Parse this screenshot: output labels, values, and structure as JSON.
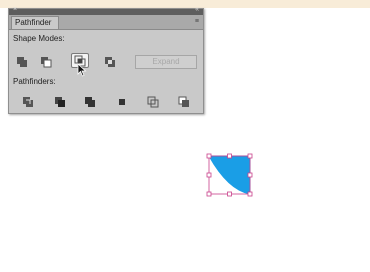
{
  "panel": {
    "close_glyph": "×",
    "collapse_glyph": "«",
    "tab_label": "Pathfinder",
    "menu_glyph": "≡",
    "shape_modes_label": "Shape Modes:",
    "expand_label": "Expand",
    "pathfinders_label": "Pathfinders:"
  },
  "shape_modes": [
    "unite-icon",
    "minus-front-icon",
    "intersect-icon",
    "exclude-icon"
  ],
  "pathfinders": [
    "divide-icon",
    "trim-icon",
    "merge-icon",
    "crop-icon",
    "outline-icon",
    "minus-back-icon"
  ],
  "colors": {
    "shape_fill": "#1a9ee6",
    "selection": "#c9408a",
    "panel_bg": "#c9c9c9"
  }
}
